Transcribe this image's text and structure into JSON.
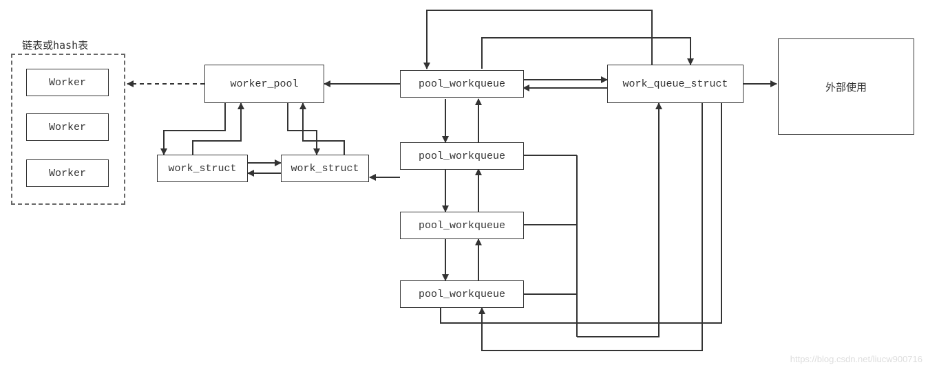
{
  "group": {
    "title": "链表或hash表",
    "workers": [
      "Worker",
      "Worker",
      "Worker"
    ]
  },
  "nodes": {
    "worker_pool": "worker_pool",
    "work_struct_1": "work_struct",
    "work_struct_2": "work_struct",
    "pool_workqueue_1": "pool_workqueue",
    "pool_workqueue_2": "pool_workqueue",
    "pool_workqueue_3": "pool_workqueue",
    "pool_workqueue_4": "pool_workqueue",
    "work_queue_struct": "work_queue_struct",
    "external_use": "外部使用"
  },
  "watermark": "https://blog.csdn.net/liucw900716"
}
